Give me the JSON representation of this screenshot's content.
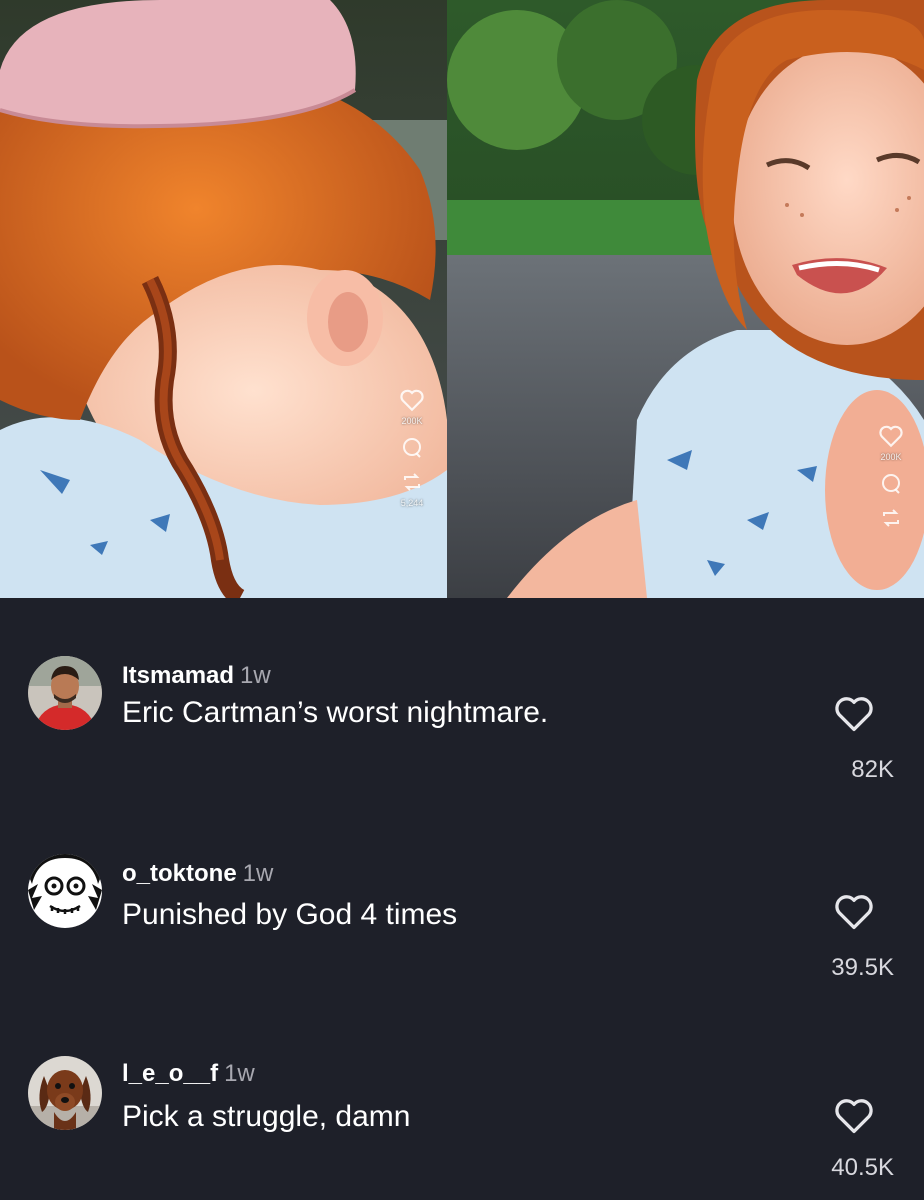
{
  "video": {
    "left_frame": {
      "like_count": "200K",
      "share_count": "5,244"
    },
    "right_frame": {
      "like_count": "200K"
    }
  },
  "comments": [
    {
      "username": "Itsmamad",
      "age": "1w",
      "text": "Eric Cartman’s worst nightmare.",
      "likes": "82K",
      "avatar": "man-red-shirt-avatar"
    },
    {
      "username": "o_toktone",
      "age": "1w",
      "text": "Punished by God 4 times",
      "likes": "39.5K",
      "avatar": "cartoon-face-avatar"
    },
    {
      "username": "l_e_o__f",
      "age": "1w",
      "text": "Pick a struggle, damn",
      "likes": "40.5K",
      "avatar": "dog-avatar"
    }
  ],
  "colors": {
    "background": "#1e2029",
    "text": "#ffffff",
    "muted": "#a8a8b0",
    "hair": "#d9661e",
    "shirt": "#cfe3f2"
  },
  "icons": [
    "heart-icon",
    "comment-icon",
    "share-icon"
  ]
}
